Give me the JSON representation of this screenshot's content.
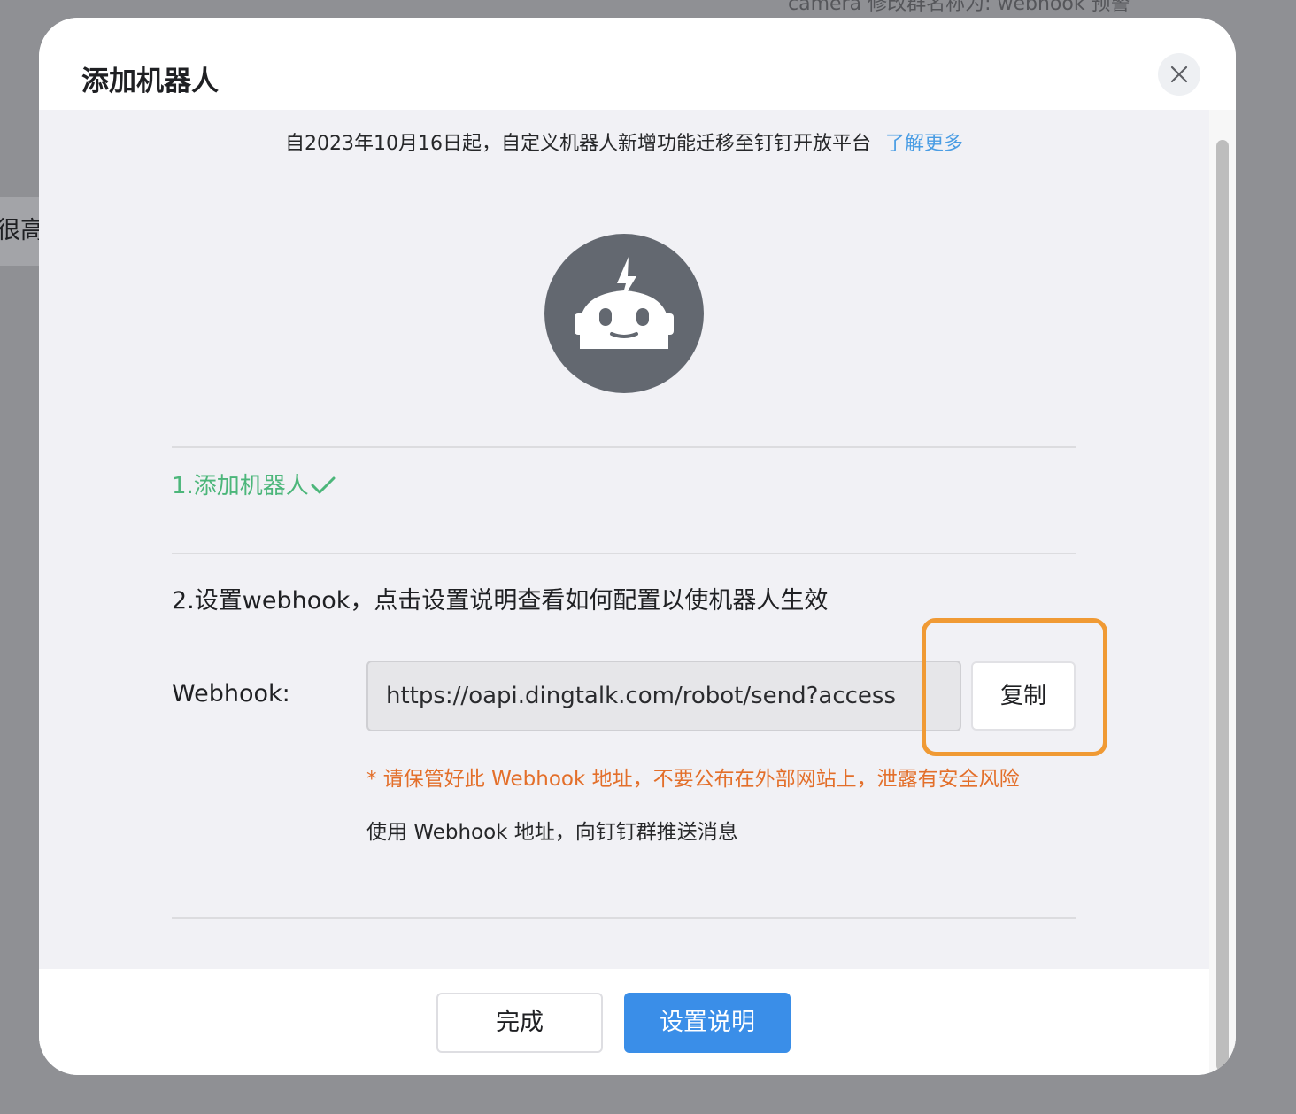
{
  "background": {
    "top_text": "camera 修改群名称为: webhook 预警",
    "left_chip_text": "很高"
  },
  "dialog": {
    "title": "添加机器人",
    "notice": {
      "text": "自2023年10月16日起，自定义机器人新增功能迁移至钉钉开放平台",
      "link_text": "了解更多"
    },
    "avatar_icon": "robot-icon",
    "step1_label": "1.添加机器人",
    "step2_label": "2.设置webhook，点击设置说明查看如何配置以使机器人生效",
    "webhook": {
      "label": "Webhook:",
      "value": "https://oapi.dingtalk.com/robot/send?access",
      "copy_label": "复制"
    },
    "warning": "* 请保管好此 Webhook 地址，不要公布在外部网站上，泄露有安全风险",
    "usage": "使用 Webhook 地址，向钉钉群推送消息",
    "footer": {
      "done_label": "完成",
      "help_label": "设置说明"
    }
  },
  "colors": {
    "primary": "#3a8ee8",
    "success": "#4cb67a",
    "warning": "#e36f2a",
    "link": "#4a9de4",
    "highlight": "#f09a34"
  }
}
